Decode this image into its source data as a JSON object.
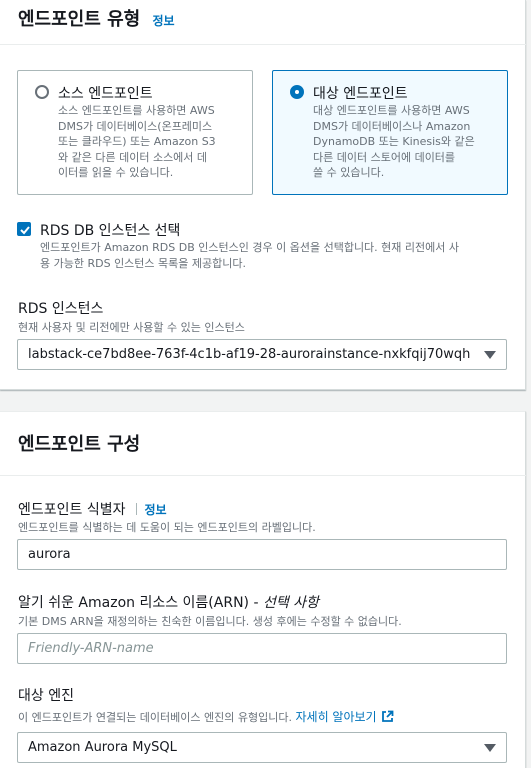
{
  "endpoint_type": {
    "heading": "엔드포인트 유형",
    "info": "정보",
    "tiles": [
      {
        "title": "소스 엔드포인트",
        "desc_lines": [
          "소스 엔드포인트를 사용하면 AWS",
          "DMS가 데이터베이스(온프레미스",
          "또는 클라우드) 또는 Amazon S3",
          "와 같은 다른 데이터 소스에서 데",
          "이터를 읽을 수 있습니다."
        ],
        "selected": false
      },
      {
        "title": "대상 엔드포인트",
        "desc_lines": [
          "대상 엔드포인트를 사용하면 AWS",
          "DMS가 데이터베이스나 Amazon",
          "DynamoDB 또는 Kinesis와 같은",
          "다른 데이터 스토어에 데이터를",
          "쓸 수 있습니다."
        ],
        "selected": true
      }
    ],
    "rds_checkbox": {
      "label": "RDS DB 인스턴스 선택",
      "checked": true,
      "desc_lines": [
        "엔드포인트가 Amazon RDS DB 인스턴스인 경우 이 옵션을 선택합니다. 현재 리전에서 사",
        "용 가능한 RDS 인스턴스 목록을 제공합니다."
      ]
    },
    "rds_instance": {
      "label": "RDS 인스턴스",
      "desc": "현재 사용자 및 리전에만 사용할 수 있는 인스턴스",
      "value": "labstack-ce7bd8ee-763f-4c1b-af19-28-aurorainstance-nxkfqij70wqh"
    }
  },
  "endpoint_config": {
    "heading": "엔드포인트 구성",
    "identifier": {
      "label": "엔드포인트 식별자",
      "info": "정보",
      "desc": "엔드포인트를 식별하는 데 도움이 되는 엔드포인트의 라벨입니다.",
      "value": "aurora"
    },
    "arn": {
      "label": "알기 쉬운 Amazon 리소스 이름(ARN) - ",
      "label_optional": "선택 사항",
      "desc": "기본 DMS ARN을 재정의하는 친숙한 이름입니다. 생성 후에는 수정할 수 없습니다.",
      "placeholder": "Friendly-ARN-name"
    },
    "engine": {
      "label": "대상 엔진",
      "desc": "이 엔드포인트가 연결되는 데이터베이스 엔진의 유형입니다.",
      "learn_more": "자세히 알아보기",
      "value": "Amazon Aurora MySQL"
    }
  },
  "colors": {
    "accent": "#0073bb",
    "selected_tile_bg": "#f1faff",
    "page_bg": "#f2f3f3"
  },
  "icons": [
    "external-link-icon",
    "check-icon",
    "caret-down-icon"
  ]
}
